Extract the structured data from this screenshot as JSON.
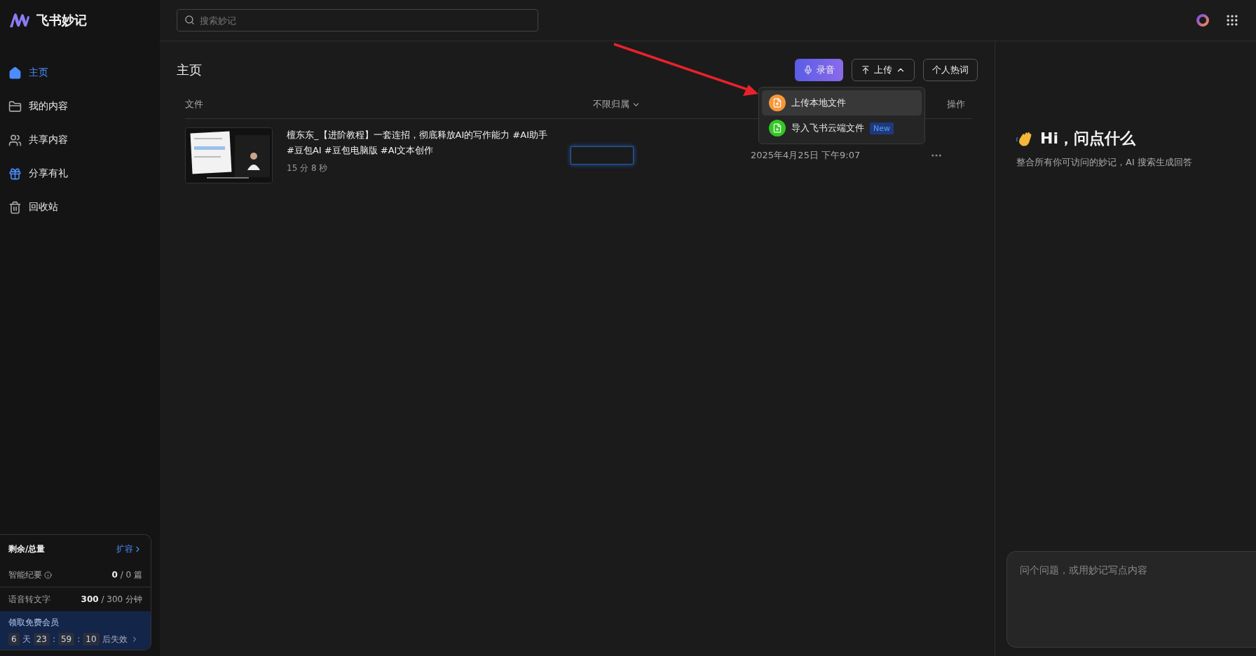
{
  "app": {
    "name": "飞书妙记"
  },
  "search": {
    "placeholder": "搜索妙记"
  },
  "sidebar": {
    "items": [
      {
        "label": "主页",
        "kind": "home",
        "selected": true
      },
      {
        "label": "我的内容",
        "kind": "folder",
        "selected": false
      },
      {
        "label": "共享内容",
        "kind": "people",
        "selected": false
      },
      {
        "label": "分享有礼",
        "kind": "gift",
        "selected": false
      },
      {
        "label": "回收站",
        "kind": "trash",
        "selected": false
      }
    ]
  },
  "quota": {
    "title": "剩余/总量",
    "expand": "扩容",
    "rows": [
      {
        "label": "智能纪要",
        "info": true,
        "used": "0",
        "rest": "/ 0 篇"
      },
      {
        "label": "语音转文字",
        "info": false,
        "used": "300",
        "rest": "/ 300 分钟"
      }
    ]
  },
  "promo": {
    "title": "领取免费会员",
    "countdown": [
      {
        "kind": "box",
        "text": "6"
      },
      {
        "kind": "unit",
        "text": "天"
      },
      {
        "kind": "box",
        "text": "23"
      },
      {
        "kind": "sep",
        "text": ":"
      },
      {
        "kind": "box",
        "text": "59"
      },
      {
        "kind": "sep",
        "text": ":"
      },
      {
        "kind": "box",
        "text": "10"
      },
      {
        "kind": "unit",
        "text": "后失效"
      }
    ]
  },
  "page": {
    "title": "主页",
    "buttons": [
      {
        "label": "录音",
        "kind": "primary"
      },
      {
        "label": "上传",
        "kind": "outline",
        "expanded": true
      },
      {
        "label": "个人热词",
        "kind": "outline"
      }
    ]
  },
  "upload_menu": {
    "items": [
      {
        "label": "上传本地文件",
        "color": "#f5973a",
        "selected": true
      },
      {
        "label": "导入飞书云端文件",
        "color": "#34c724",
        "selected": false,
        "badge": "New"
      }
    ]
  },
  "table": {
    "columns": [
      {
        "label": "文件",
        "kind": "plain"
      },
      {
        "label": "不限归属",
        "kind": "filter"
      },
      {
        "label": "操作",
        "kind": "plain"
      }
    ],
    "rows": [
      {
        "title": "檀东东_【进阶教程】一套连招，彻底释放AI的写作能力 #AI助手 #豆包AI #豆包电脑版 #AI文本创作",
        "duration": "15 分 8 秒",
        "date": "2025年4月25日 下午9:07"
      }
    ]
  },
  "assistant": {
    "greeting": "Hi，问点什么",
    "subtitle": "整合所有你可访问的妙记，AI 搜索生成回答",
    "input": {
      "placeholder": "问个问题，或用妙记写点内容"
    }
  }
}
